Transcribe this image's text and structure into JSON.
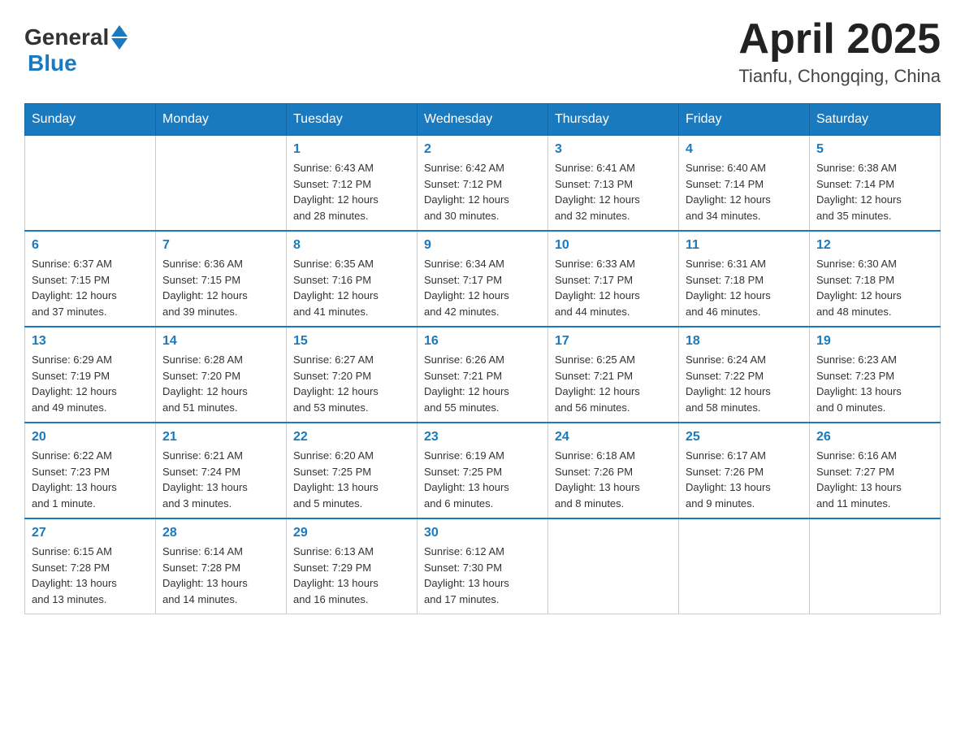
{
  "header": {
    "logo_general": "General",
    "logo_blue": "Blue",
    "month_year": "April 2025",
    "location": "Tianfu, Chongqing, China"
  },
  "weekdays": [
    "Sunday",
    "Monday",
    "Tuesday",
    "Wednesday",
    "Thursday",
    "Friday",
    "Saturday"
  ],
  "weeks": [
    [
      {
        "day": "",
        "info": ""
      },
      {
        "day": "",
        "info": ""
      },
      {
        "day": "1",
        "info": "Sunrise: 6:43 AM\nSunset: 7:12 PM\nDaylight: 12 hours\nand 28 minutes."
      },
      {
        "day": "2",
        "info": "Sunrise: 6:42 AM\nSunset: 7:12 PM\nDaylight: 12 hours\nand 30 minutes."
      },
      {
        "day": "3",
        "info": "Sunrise: 6:41 AM\nSunset: 7:13 PM\nDaylight: 12 hours\nand 32 minutes."
      },
      {
        "day": "4",
        "info": "Sunrise: 6:40 AM\nSunset: 7:14 PM\nDaylight: 12 hours\nand 34 minutes."
      },
      {
        "day": "5",
        "info": "Sunrise: 6:38 AM\nSunset: 7:14 PM\nDaylight: 12 hours\nand 35 minutes."
      }
    ],
    [
      {
        "day": "6",
        "info": "Sunrise: 6:37 AM\nSunset: 7:15 PM\nDaylight: 12 hours\nand 37 minutes."
      },
      {
        "day": "7",
        "info": "Sunrise: 6:36 AM\nSunset: 7:15 PM\nDaylight: 12 hours\nand 39 minutes."
      },
      {
        "day": "8",
        "info": "Sunrise: 6:35 AM\nSunset: 7:16 PM\nDaylight: 12 hours\nand 41 minutes."
      },
      {
        "day": "9",
        "info": "Sunrise: 6:34 AM\nSunset: 7:17 PM\nDaylight: 12 hours\nand 42 minutes."
      },
      {
        "day": "10",
        "info": "Sunrise: 6:33 AM\nSunset: 7:17 PM\nDaylight: 12 hours\nand 44 minutes."
      },
      {
        "day": "11",
        "info": "Sunrise: 6:31 AM\nSunset: 7:18 PM\nDaylight: 12 hours\nand 46 minutes."
      },
      {
        "day": "12",
        "info": "Sunrise: 6:30 AM\nSunset: 7:18 PM\nDaylight: 12 hours\nand 48 minutes."
      }
    ],
    [
      {
        "day": "13",
        "info": "Sunrise: 6:29 AM\nSunset: 7:19 PM\nDaylight: 12 hours\nand 49 minutes."
      },
      {
        "day": "14",
        "info": "Sunrise: 6:28 AM\nSunset: 7:20 PM\nDaylight: 12 hours\nand 51 minutes."
      },
      {
        "day": "15",
        "info": "Sunrise: 6:27 AM\nSunset: 7:20 PM\nDaylight: 12 hours\nand 53 minutes."
      },
      {
        "day": "16",
        "info": "Sunrise: 6:26 AM\nSunset: 7:21 PM\nDaylight: 12 hours\nand 55 minutes."
      },
      {
        "day": "17",
        "info": "Sunrise: 6:25 AM\nSunset: 7:21 PM\nDaylight: 12 hours\nand 56 minutes."
      },
      {
        "day": "18",
        "info": "Sunrise: 6:24 AM\nSunset: 7:22 PM\nDaylight: 12 hours\nand 58 minutes."
      },
      {
        "day": "19",
        "info": "Sunrise: 6:23 AM\nSunset: 7:23 PM\nDaylight: 13 hours\nand 0 minutes."
      }
    ],
    [
      {
        "day": "20",
        "info": "Sunrise: 6:22 AM\nSunset: 7:23 PM\nDaylight: 13 hours\nand 1 minute."
      },
      {
        "day": "21",
        "info": "Sunrise: 6:21 AM\nSunset: 7:24 PM\nDaylight: 13 hours\nand 3 minutes."
      },
      {
        "day": "22",
        "info": "Sunrise: 6:20 AM\nSunset: 7:25 PM\nDaylight: 13 hours\nand 5 minutes."
      },
      {
        "day": "23",
        "info": "Sunrise: 6:19 AM\nSunset: 7:25 PM\nDaylight: 13 hours\nand 6 minutes."
      },
      {
        "day": "24",
        "info": "Sunrise: 6:18 AM\nSunset: 7:26 PM\nDaylight: 13 hours\nand 8 minutes."
      },
      {
        "day": "25",
        "info": "Sunrise: 6:17 AM\nSunset: 7:26 PM\nDaylight: 13 hours\nand 9 minutes."
      },
      {
        "day": "26",
        "info": "Sunrise: 6:16 AM\nSunset: 7:27 PM\nDaylight: 13 hours\nand 11 minutes."
      }
    ],
    [
      {
        "day": "27",
        "info": "Sunrise: 6:15 AM\nSunset: 7:28 PM\nDaylight: 13 hours\nand 13 minutes."
      },
      {
        "day": "28",
        "info": "Sunrise: 6:14 AM\nSunset: 7:28 PM\nDaylight: 13 hours\nand 14 minutes."
      },
      {
        "day": "29",
        "info": "Sunrise: 6:13 AM\nSunset: 7:29 PM\nDaylight: 13 hours\nand 16 minutes."
      },
      {
        "day": "30",
        "info": "Sunrise: 6:12 AM\nSunset: 7:30 PM\nDaylight: 13 hours\nand 17 minutes."
      },
      {
        "day": "",
        "info": ""
      },
      {
        "day": "",
        "info": ""
      },
      {
        "day": "",
        "info": ""
      }
    ]
  ]
}
